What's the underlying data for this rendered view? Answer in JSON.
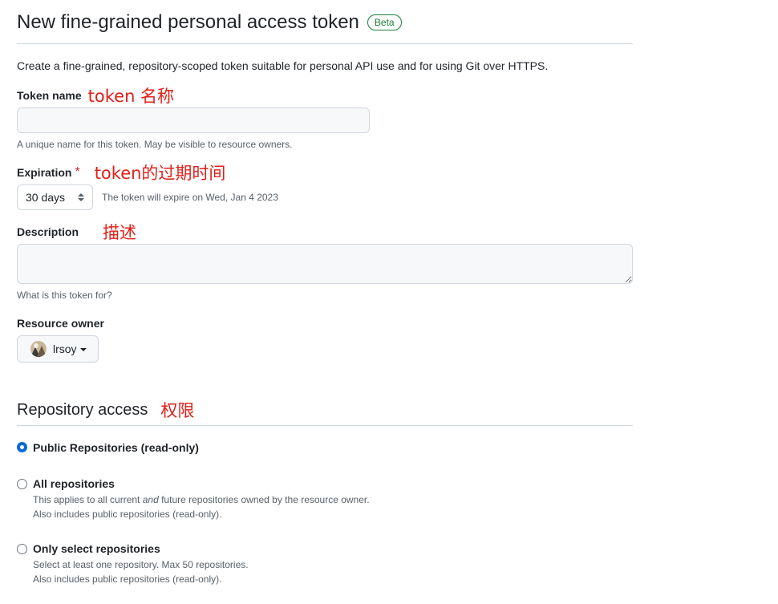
{
  "header": {
    "title": "New fine-grained personal access token",
    "badge": "Beta",
    "intro": "Create a fine-grained, repository-scoped token suitable for personal API use and for using Git over HTTPS."
  },
  "token_name": {
    "label": "Token name",
    "annotation": "token 名称",
    "value": "",
    "hint": "A unique name for this token. May be visible to resource owners."
  },
  "expiration": {
    "label": "Expiration",
    "required_mark": "*",
    "annotation": "token的过期时间",
    "selected": "30 days",
    "hint": "The token will expire on Wed, Jan 4 2023"
  },
  "description": {
    "label": "Description",
    "annotation": "描述",
    "value": "",
    "hint": "What is this token for?"
  },
  "resource_owner": {
    "label": "Resource owner",
    "selected": "lrsoy"
  },
  "repository_access": {
    "title": "Repository access",
    "annotation": "权限",
    "options": [
      {
        "label": "Public Repositories (read-only)",
        "checked": true
      },
      {
        "label": "All repositories",
        "checked": false,
        "desc_pre": "This applies to all current ",
        "desc_em": "and",
        "desc_post": " future repositories owned by the resource owner.",
        "desc_line2": "Also includes public repositories (read-only)."
      },
      {
        "label": "Only select repositories",
        "checked": false,
        "desc_line1": "Select at least one repository. Max 50 repositories.",
        "desc_line2": "Also includes public repositories (read-only)."
      }
    ]
  },
  "colors": {
    "annotation_red": "#e0201a",
    "accent_blue": "#0969da",
    "beta_green": "#1a7f37"
  }
}
